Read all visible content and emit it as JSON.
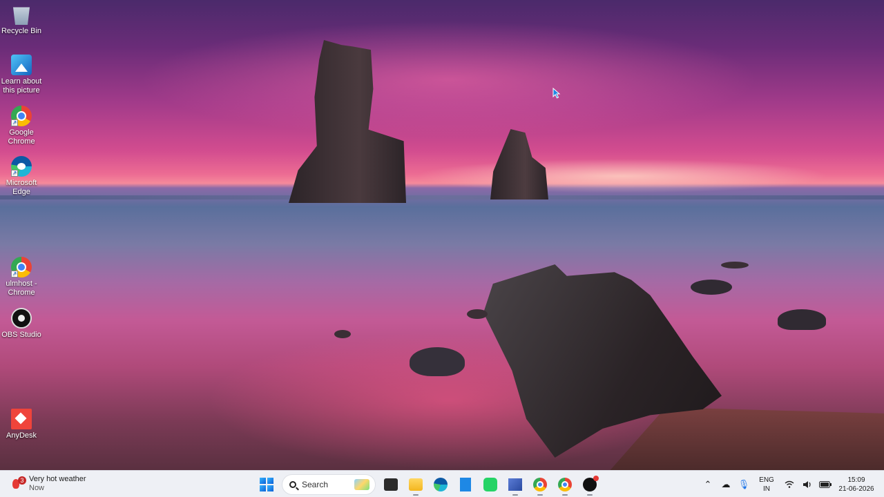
{
  "desktop": {
    "icons": [
      {
        "label": "Recycle Bin",
        "icon": "recycle-bin-icon"
      },
      {
        "label": "Learn about this picture",
        "icon": "learn-picture-icon"
      },
      {
        "label": "Google Chrome",
        "icon": "chrome-icon"
      },
      {
        "label": "Microsoft Edge",
        "icon": "edge-icon"
      },
      {
        "label": "ulmhost - Chrome",
        "icon": "chrome-profile-icon"
      },
      {
        "label": "OBS Studio",
        "icon": "obs-icon"
      },
      {
        "label": "AnyDesk",
        "icon": "anydesk-icon"
      }
    ]
  },
  "taskbar": {
    "weather": {
      "title": "Very hot weather",
      "subtitle": "Now",
      "badge": "3"
    },
    "search": {
      "placeholder": "Search"
    },
    "apps": [
      {
        "name": "start",
        "icon": "windows-logo-icon"
      },
      {
        "name": "terminal",
        "icon": "terminal-icon"
      },
      {
        "name": "file-explorer",
        "icon": "folder-icon"
      },
      {
        "name": "edge",
        "icon": "edge-icon"
      },
      {
        "name": "notepad",
        "icon": "notepad-icon"
      },
      {
        "name": "whatsapp",
        "icon": "whatsapp-icon"
      },
      {
        "name": "network",
        "icon": "network-icon"
      },
      {
        "name": "chrome",
        "icon": "chrome-icon"
      },
      {
        "name": "chrome-profile",
        "icon": "chrome-profile-icon"
      },
      {
        "name": "obs",
        "icon": "obs-icon"
      }
    ],
    "tray": {
      "language_line1": "ENG",
      "language_line2": "IN",
      "time": "15:09",
      "date": "21-06-2026"
    }
  },
  "colors": {
    "taskbar_bg": "#eef0f5",
    "accent": "#0a5fd6"
  }
}
